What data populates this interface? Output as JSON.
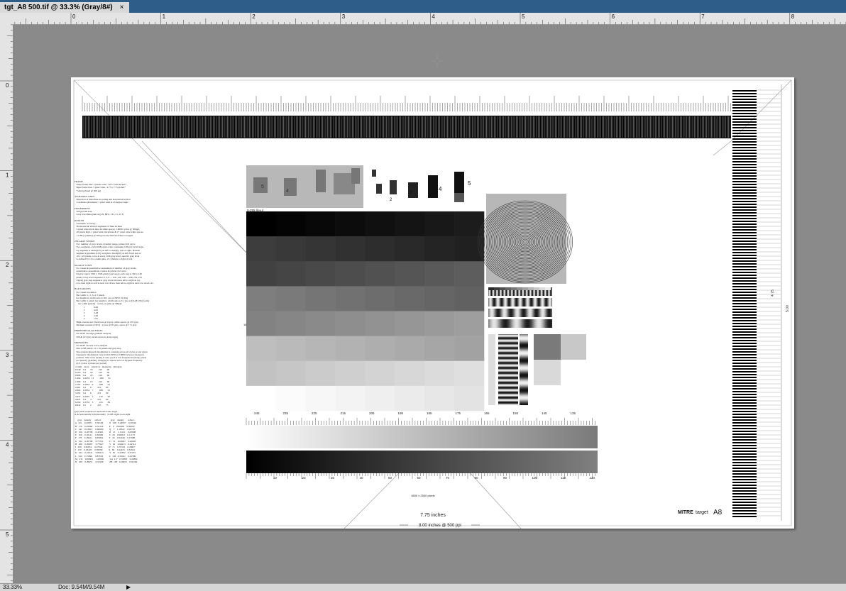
{
  "tab": {
    "title": "tgt_A8 500.tif @ 33.3% (Gray/8#)",
    "close": "×"
  },
  "ruler": {
    "h_labels": [
      "0",
      "1",
      "2",
      "3",
      "4",
      "5",
      "6",
      "7",
      "8"
    ],
    "v_labels": [
      "0",
      "1",
      "2",
      "3",
      "4",
      "5"
    ]
  },
  "status": {
    "zoom": "33.33%",
    "doc": "Doc: 9.54M/9.54M",
    "arrow": "▶"
  },
  "target": {
    "legend_text": "FRAME\n   Outer frame line: 2 pixels wide, 7.65 x 5.00 inches*\n   Inner frame line: 3 pixel wide,  4.75 x 7.75 inches*\n   *when printed @ 500 ppi\n\n45 DEGREE LINES\n   Detection of distortion in scaling and horizontal/vertical\n   coordinate placement; 1 pixel wide at 45 degree angle\n\nFINGERPRINT\n   500 ppi ink scan\n   Gray level histogram avg 29, 89%, 131, 21, 25 8\n\nRONCHI\n   Geometric accuracy:\n   Horizontal & Vertical segments of lines & lines\n   5-pixel wide black lines & white spaces, 1.0000 cycles @ 500ppi,\n   20 pixels high, 1 pixel wide black lines & 17 pixel wide white spaces,\n   1.0 Hz (cylinder) @ 500 ppi scale 500 black line is longest\n\n256-GRAY WEDGE\n   For: number of gray levels, dynamic range, printed I/O curve\n   Two segments, each 2048 pixels wide containing 128 gray level steps,\n   top segment is white(255) on left to dark(0), 130 on right. Bottom\n   segment is gradient (125) on right to black(00) on left. Each step is\n   16 x 123 pixels, to be in every 10th gray level, specific gray level\n   is defined by 16 x column plus 15 columns to right of tick\n\n64-GRAY STEPS\n   For visual & quantitative assessment of number of gray levels,\n   quantitative assessment of noise & printer I/O curve\n   64 gray steps (1302 x 1326 pixels total area); each step is 160 x 148\n   pixels; Gray level sequence 0, 4, 8 ... 120, 124, 128 ... 248, 252, 255\n   Zigzag gray step sequence: gray levels increase left-to-right in top\n   row, then right-to-left in next row down, then left-to-right in next row down, etc.\n\nBAR TARGETS\n   For visual resolution\n   Bar width: 1, 2, 3, 4, 5 pixels\n   bar lengths in width ratio is 20:1 (as on NIST 1010A)\n   Bar width: 1 pixel; bar length to width ratio is 5:1 (as on USAF-1951 form)\n      bar width (pixels)   cycles-on-print @ 500ppi\n               1               9.84\n               2               4.92\n               3               3.28\n               4               2.46\n               5               1.97\n   High contrast set: black bars @ 0 gray, white spaces @ 255 gray\n   Medium contrast (CD:2) : 2 bars @ 95 gray, space @ 171 gray\n\nPERPENDICULAR EDGES\n   For MTF via edge gradient analysis\n   200 & 125 gray levels (narrow slant target)\n\nSINEWAVES\n   For MTF via sine wave analysis\n   664 x 228 pixels; 12 x 10 panels and gray step\n   Sine pattern phase & modulation is constant across all cycles at any given\n   frequency; modulation vary from 0.0970 to 0.9800 between frequency\n   patterns. Sine wave quality is very good at low frequencies (many pixels\n   per period), gradually changing to square wave at Nyquist frequency\n   (2.0 cycles, 2 pixels per period)\n cy/mm    mod.    pixels/cy   meangray   min/gray\n 0.249    0.4       79          210        90\n 0.503    0.4       50          210        90\n 0.984    0.4       20          210        90\n 1.964    0.3953   13          289        91\n 1.969    0.4       10          210        90\n 2.187    0.3953    9          288        91\n 2.461    0.4       8          210        90\n 2.802    0.3953    7          289        91\n 3.281    0.4       6          210        90\n 3.937    0.4007    5          210        90\n 4.921    0.4       4          210        90\n 6.562    0.3533    3          225        89\n 9.842    0.5       2          225        75\n\ngray patch sequence in horizontal sine target\nA-K horizontally in horizontally   O-ZB: right-to-on-right\n\n     gray    density      reflect.               gray    density      reflect.\n A   221    0.29971     0.50194          O   228   0.29957    0.50196\n B   176    0.26666     0.54118          P    0    0.00000    0.00000\n C   141    0.23621     0.68299          Q    7    1.16541    0.02745\n D   106    0.20798     0.41961          R   13    1.15121    0.05098\n E   160    0.18121     0.63982          S   20    0.96053    0.11173\n F   176    0.18421     0.69064          T   40    0.92446    0.15686\n G   192    0.20798     0.75701          U   51    0.64947    0.20000\n H   208    0.20987     0.77647          V   62    0.60413    0.24314\n I   209    0.20034     0.47949          W   71    0.55322    0.28627\n J   210    0.18403     0.82099          X   84    0.44223    0.32941\n K   224    0.16441     0.89413          Y   95    0.42392    0.37255\n L   230    0.15996     0.87033          Z   106   0.33421    0.41569\n M   232    0.06603     1.00000          ZA  117   0.33893    0.45882\n N   228    0.29951     0.50196          ZB  128   0.29953    0.50196",
    "bar_labels": [
      "5",
      "4",
      "3",
      "2",
      "1",
      "5",
      "4",
      "3",
      "2",
      "1"
    ],
    "small_bar_labels": [
      "1",
      "2",
      "3",
      "4",
      "5"
    ],
    "gray_label": "0-255 (lev.4",
    "wedge_top_labels": [
      "245",
      "235",
      "225",
      "215",
      "205",
      "195",
      "185",
      "175",
      "165",
      "155",
      "145",
      "135"
    ],
    "wedge_bottom_labels": [
      "10",
      "20",
      "30",
      "40",
      "50",
      "60",
      "70",
      "80",
      "90",
      "100",
      "110",
      "120"
    ],
    "pixels_label": "4600 x 2500 pixels",
    "width_label": "7.75 inches",
    "arrow_label": "8.00 inches @ 500 ppi",
    "height_inner": "4.75",
    "height_outer": "5.00",
    "brand": "MITRE",
    "brand_suffix": "target",
    "target_id": "A8",
    "step_side_label": "16"
  }
}
